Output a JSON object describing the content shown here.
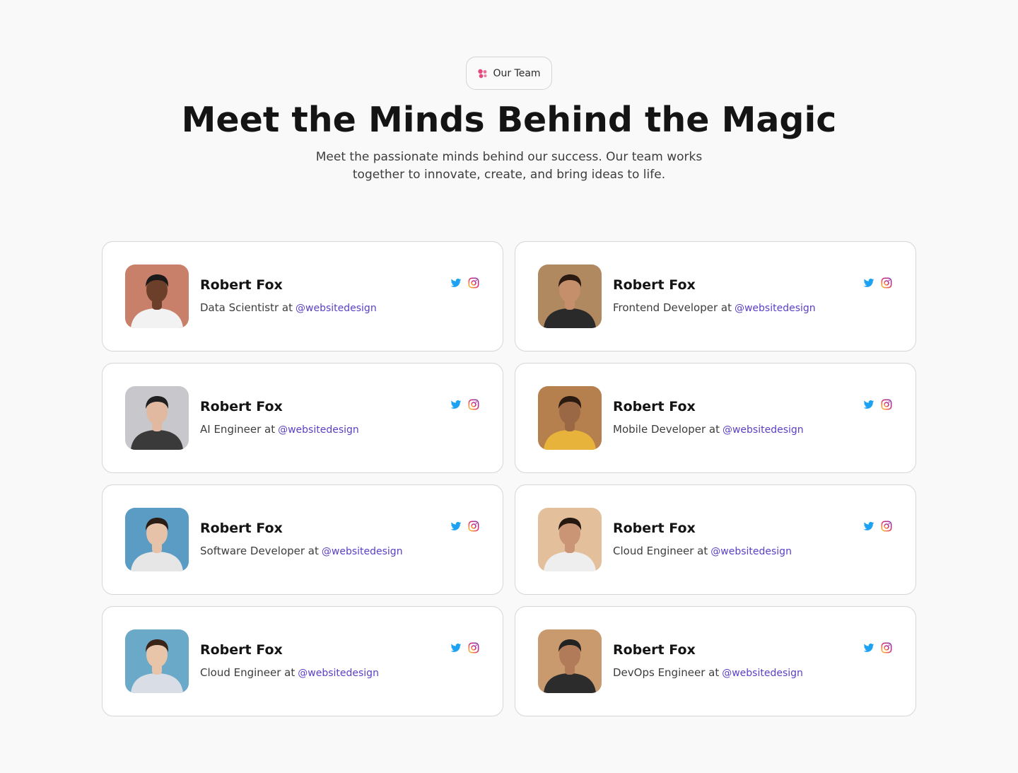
{
  "badge": {
    "label": "Our Team",
    "icon": "team-icon",
    "icon_color": "#e24b7d"
  },
  "heading": {
    "title": "Meet the Minds Behind the Magic",
    "subtitle": "Meet the passionate minds behind our success. Our team works together to innovate, create, and bring ideas to life."
  },
  "colors": {
    "accent": "#5b3fc4",
    "twitter": "#1da1f2",
    "instagram": "#d6249f"
  },
  "members": [
    {
      "name": "Robert Fox",
      "role": "Data Scientistr at",
      "handle": "@websitedesign",
      "avatar": "avatar-photo",
      "bg": "#c9806a",
      "skin": "#6b3f2a",
      "shirt": "#f2f2f2",
      "hair": "#1a1a1a"
    },
    {
      "name": "Robert Fox",
      "role": "Frontend Developer at",
      "handle": "@websitedesign",
      "avatar": "avatar-photo",
      "bg": "#b08960",
      "skin": "#c48f6a",
      "shirt": "#2a2a2a",
      "hair": "#2a1a12"
    },
    {
      "name": "Robert Fox",
      "role": "AI Engineer at",
      "handle": "@websitedesign",
      "avatar": "avatar-photo",
      "bg": "#c8c8cc",
      "skin": "#e0b9a0",
      "shirt": "#3a3a3a",
      "hair": "#1f1f1f"
    },
    {
      "name": "Robert Fox",
      "role": "Mobile Developer at",
      "handle": "@websitedesign",
      "avatar": "avatar-photo",
      "bg": "#b57f4e",
      "skin": "#9a6845",
      "shirt": "#e8b33a",
      "hair": "#2b1a10"
    },
    {
      "name": "Robert Fox",
      "role": "Software Developer at",
      "handle": "@websitedesign",
      "avatar": "avatar-photo",
      "bg": "#5a9cc4",
      "skin": "#e6c2a8",
      "shirt": "#e6e6e6",
      "hair": "#2a1d16"
    },
    {
      "name": "Robert Fox",
      "role": "Cloud Engineer at",
      "handle": "@websitedesign",
      "avatar": "avatar-photo",
      "bg": "#e3bf9c",
      "skin": "#c99574",
      "shirt": "#eeeeee",
      "hair": "#241810"
    },
    {
      "name": "Robert Fox",
      "role": "Cloud Engineer at",
      "handle": "@websitedesign",
      "avatar": "avatar-photo",
      "bg": "#6aa9c8",
      "skin": "#e8c4a8",
      "shirt": "#d8dde6",
      "hair": "#3a2418"
    },
    {
      "name": "Robert Fox",
      "role": "DevOps Engineer at",
      "handle": "@websitedesign",
      "avatar": "avatar-photo",
      "bg": "#c99a6e",
      "skin": "#b17a58",
      "shirt": "#2c2c2c",
      "hair": "#222222"
    }
  ]
}
